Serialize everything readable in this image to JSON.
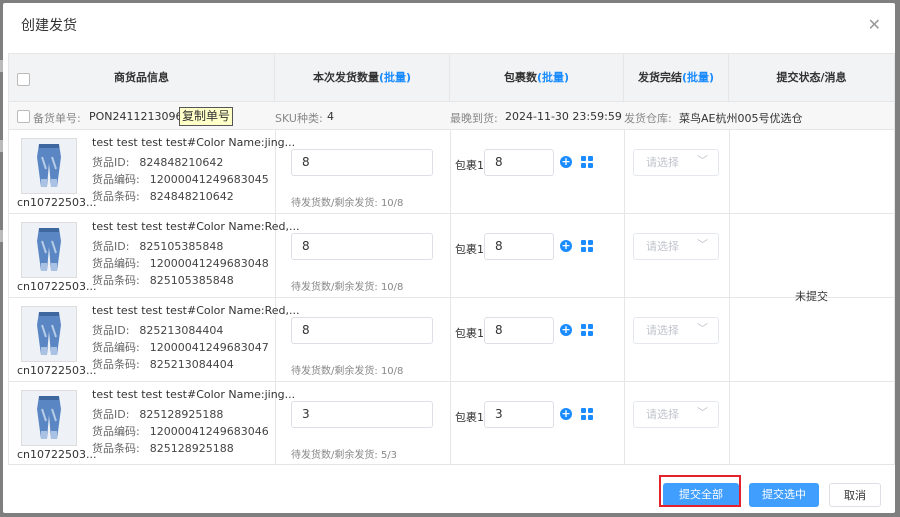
{
  "dialog": {
    "title": "创建发货",
    "close_icon": "close-icon"
  },
  "table": {
    "headers": {
      "product_info": "商货品信息",
      "ship_qty": "本次发货数量",
      "ship_qty_batch": "(批量)",
      "package_count": "包裹数",
      "package_batch": "(批量)",
      "ship_done": "发货完结",
      "ship_done_batch": "(批量)",
      "submit_status": "提交状态/消息"
    },
    "infobar": {
      "order_label": "备货单号:",
      "order_no": "PON24112130962",
      "copy_label": "复制单号",
      "sku_label": "SKU种类:",
      "sku_value": "4",
      "deadline_label": "最晚到货:",
      "deadline_value": "2024-11-30 23:59:59",
      "warehouse_label": "发货仓库:",
      "warehouse_value": "菜鸟AE杭州005号优选仓"
    },
    "labels": {
      "goods_id": "货品ID:",
      "goods_code": "货品编码:",
      "goods_barcode": "货品条码:",
      "pending_remaining": "待发货数/剩余发货:",
      "package": "包裹1",
      "select_placeholder": "请选择"
    },
    "rows": [
      {
        "sku": "cn10722503...",
        "name": "test test test test#Color Name:jing...",
        "goods_id": "824848210642",
        "goods_code": "12000041249683045",
        "barcode": "824848210642",
        "qty": "8",
        "pending": "10/8",
        "package_qty": "8"
      },
      {
        "sku": "cn10722503...",
        "name": "test test test test#Color Name:Red,...",
        "goods_id": "825105385848",
        "goods_code": "12000041249683048",
        "barcode": "825105385848",
        "qty": "8",
        "pending": "10/8",
        "package_qty": "8"
      },
      {
        "sku": "cn10722503...",
        "name": "test test test test#Color Name:Red,...",
        "goods_id": "825213084404",
        "goods_code": "12000041249683047",
        "barcode": "825213084404",
        "qty": "8",
        "pending": "10/8",
        "package_qty": "8"
      },
      {
        "sku": "cn10722503...",
        "name": "test test test test#Color Name:jing...",
        "goods_id": "825128925188",
        "goods_code": "12000041249683046",
        "barcode": "825128925188",
        "qty": "3",
        "pending": "5/3",
        "package_qty": "3"
      }
    ],
    "status": "未提交"
  },
  "footer": {
    "submit_all": "提交全部",
    "submit_selected": "提交选中",
    "cancel": "取消"
  },
  "colors": {
    "accent": "#409eff",
    "link": "#1a8cff",
    "highlight": "#e5212b"
  }
}
